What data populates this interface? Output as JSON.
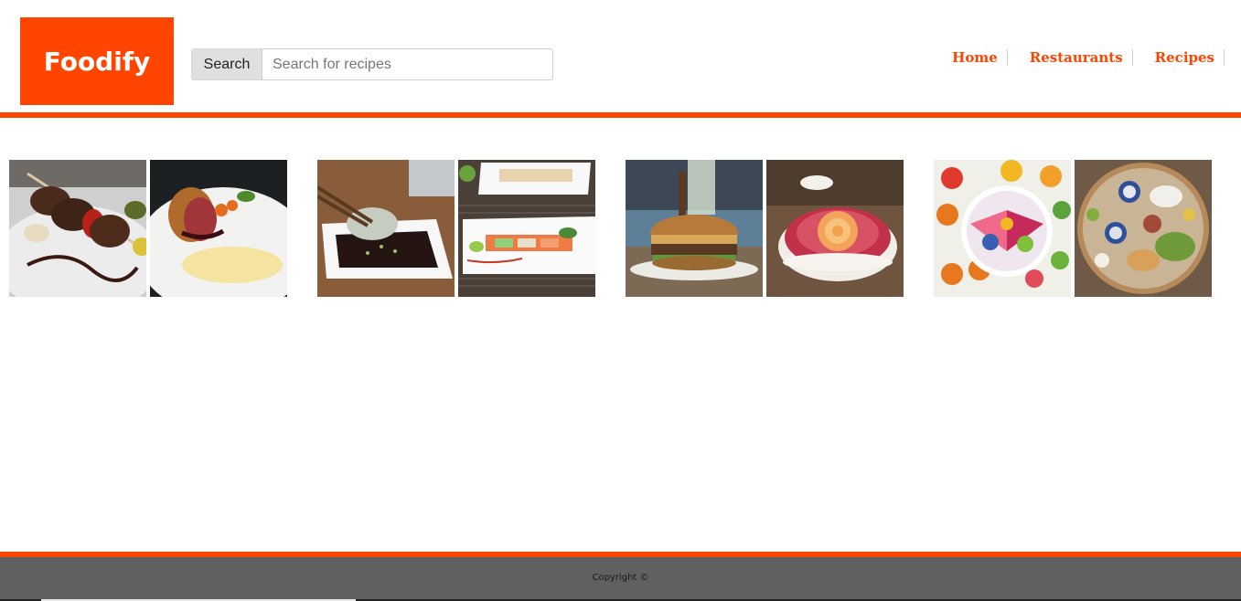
{
  "brand": {
    "name": "Foodify",
    "color": "#ff4500"
  },
  "search": {
    "label": "Search",
    "placeholder": "Search for recipes"
  },
  "nav": {
    "items": [
      {
        "label": "Home"
      },
      {
        "label": "Restaurants"
      },
      {
        "label": "Recipes"
      }
    ]
  },
  "gallery": {
    "groups": [
      {
        "images": [
          {
            "subject": "steak skewer on white plate"
          },
          {
            "subject": "beef wellington with mashed potato"
          }
        ]
      },
      {
        "images": [
          {
            "subject": "dumpling dipped in soy sauce"
          },
          {
            "subject": "sushi rolls on white platters"
          }
        ]
      },
      {
        "images": [
          {
            "subject": "burger on plate"
          },
          {
            "subject": "peach rose tart"
          }
        ]
      },
      {
        "images": [
          {
            "subject": "fruit smoothie bowl"
          },
          {
            "subject": "grazing board"
          }
        ]
      }
    ]
  },
  "footer": {
    "copyright": "Copyright ©"
  }
}
